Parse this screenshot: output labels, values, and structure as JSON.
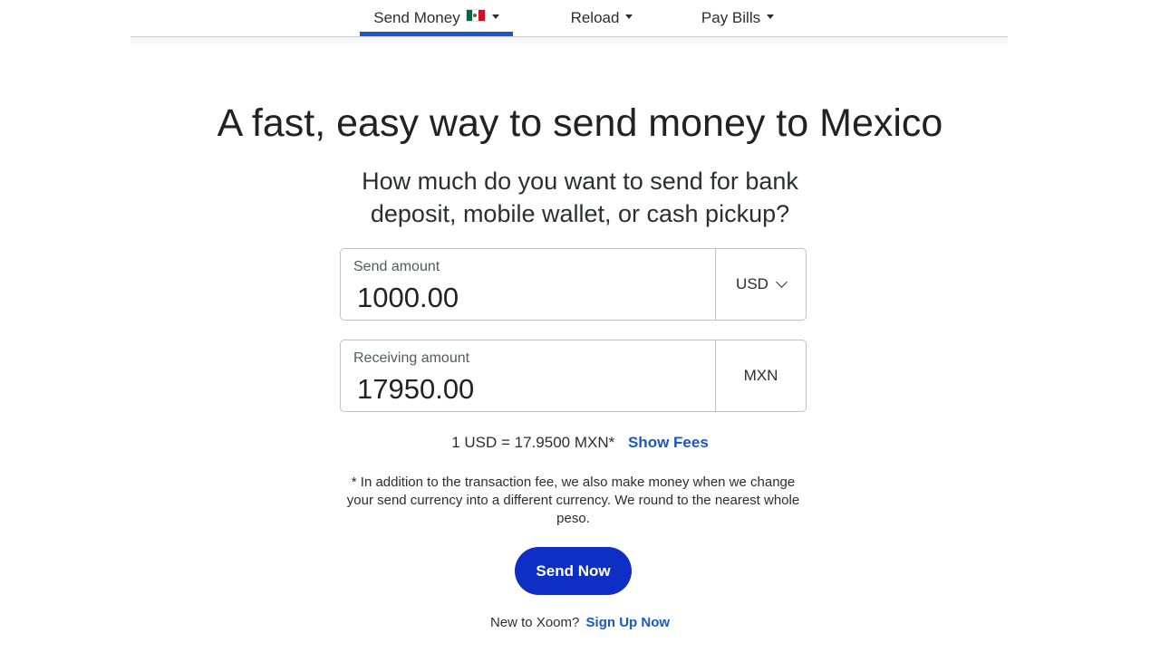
{
  "nav": {
    "items": [
      {
        "label": "Send Money",
        "flag": "mexico-flag",
        "active": true
      },
      {
        "label": "Reload",
        "active": false
      },
      {
        "label": "Pay Bills",
        "active": false
      }
    ]
  },
  "hero": {
    "title": "A fast, easy way to send money to Mexico",
    "question_line1": "How much do you want to send for bank",
    "question_line2": "deposit, mobile wallet, or cash pickup?"
  },
  "send": {
    "label": "Send amount",
    "value": "1000.00",
    "currency": "USD"
  },
  "receive": {
    "label": "Receiving amount",
    "value": "17950.00",
    "currency": "MXN"
  },
  "rate": {
    "text": "1 USD = 17.9500 MXN*",
    "fees_link": "Show Fees"
  },
  "disclaimer": "* In addition to the transaction fee, we also make money when we change your send currency into a different currency. We round to the nearest whole peso.",
  "cta": {
    "label": "Send Now"
  },
  "signup": {
    "prompt": "New to Xoom?",
    "link": "Sign Up Now"
  },
  "colors": {
    "accent": "#1a57c9",
    "button": "#0f2fc4",
    "text": "#2c2e2f"
  }
}
